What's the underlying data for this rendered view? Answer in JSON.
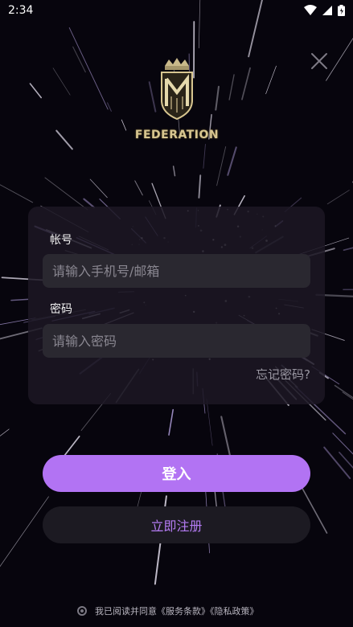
{
  "status_bar": {
    "time": "2:34",
    "icons": [
      "wifi-icon",
      "signal-icon",
      "battery-icon"
    ]
  },
  "brand": {
    "name": "FEDERATION"
  },
  "form": {
    "account_label": "帐号",
    "account_placeholder": "请输入手机号/邮箱",
    "password_label": "密码",
    "password_placeholder": "请输入密码",
    "forgot_password": "忘记密码?"
  },
  "actions": {
    "login_label": "登入",
    "register_label": "立即注册"
  },
  "agreement": {
    "text": "我已阅读并同意《服务条款》《隐私政策》",
    "checked": false
  },
  "colors": {
    "accent": "#b273f3",
    "accent_text": "#b57cf4",
    "background": "#07050d",
    "brand_gold": "#d8c690"
  }
}
